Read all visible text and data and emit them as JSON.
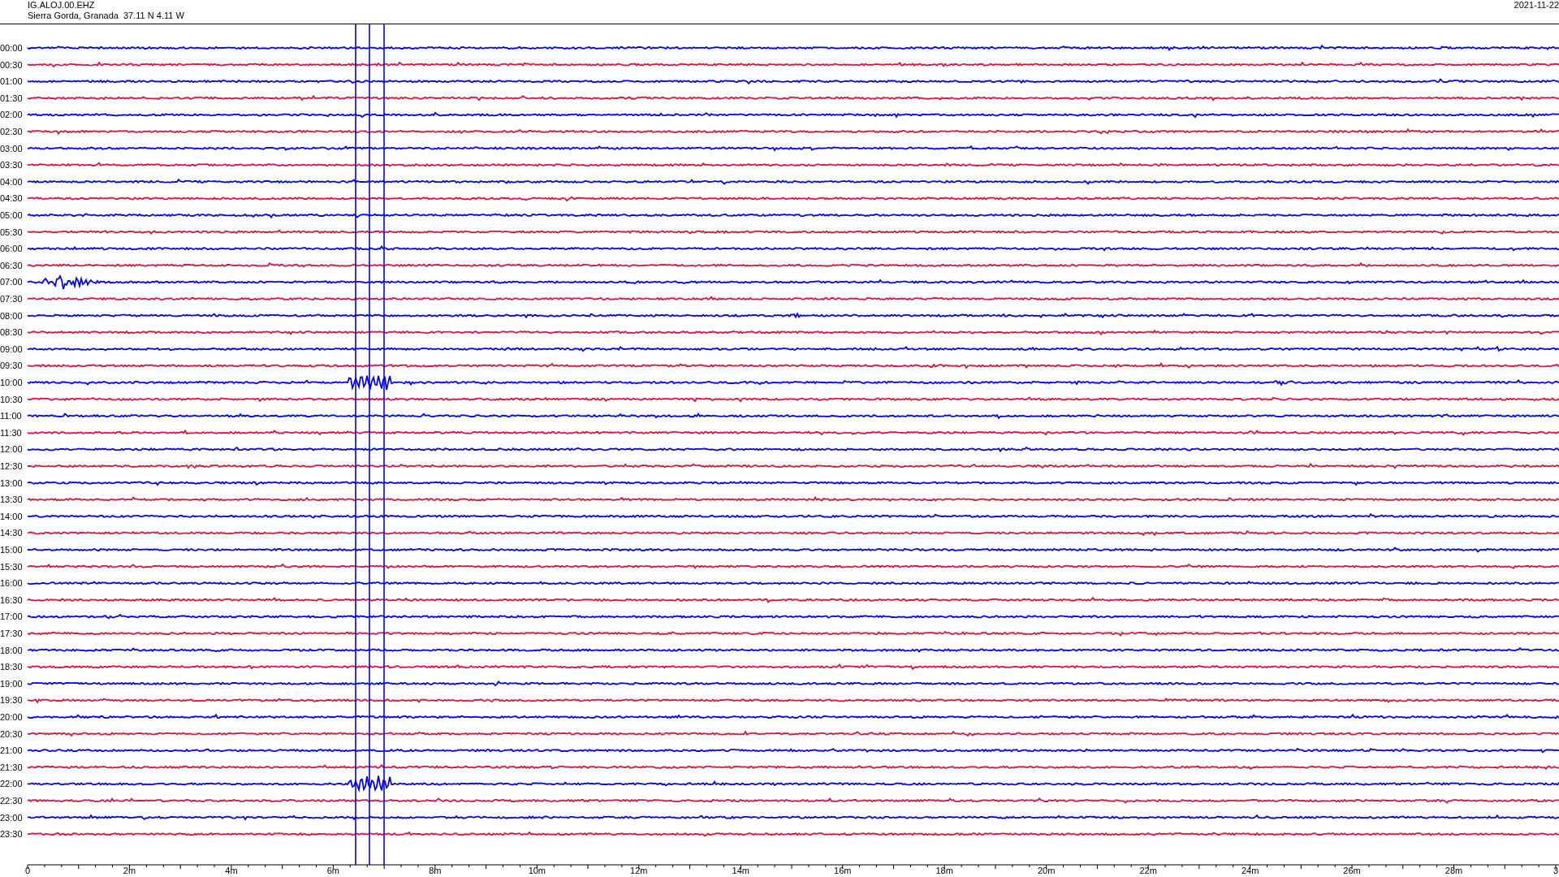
{
  "header": {
    "channel": "IG.ALOJ.00.EHZ",
    "station": "Sierra Gorda, Granada  37.11 N 4.11 W",
    "date": "2021-11-22"
  },
  "rows": [
    {
      "time": "00:00",
      "color": "#0000ff"
    },
    {
      "time": "00:30",
      "color": "#dc143c"
    },
    {
      "time": "01:00",
      "color": "#0000ff"
    },
    {
      "time": "01:30",
      "color": "#dc143c"
    },
    {
      "time": "02:00",
      "color": "#0000ff"
    },
    {
      "time": "02:30",
      "color": "#dc143c"
    },
    {
      "time": "03:00",
      "color": "#0000ff"
    },
    {
      "time": "03:30",
      "color": "#dc143c"
    },
    {
      "time": "04:00",
      "color": "#0000ff"
    },
    {
      "time": "04:30",
      "color": "#dc143c"
    },
    {
      "time": "05:00",
      "color": "#0000ff"
    },
    {
      "time": "05:30",
      "color": "#dc143c"
    },
    {
      "time": "06:00",
      "color": "#0000ff"
    },
    {
      "time": "06:30",
      "color": "#dc143c"
    },
    {
      "time": "07:00",
      "color": "#0000ff"
    },
    {
      "time": "07:30",
      "color": "#dc143c"
    },
    {
      "time": "08:00",
      "color": "#0000ff"
    },
    {
      "time": "08:30",
      "color": "#dc143c"
    },
    {
      "time": "09:00",
      "color": "#0000ff"
    },
    {
      "time": "09:30",
      "color": "#dc143c"
    },
    {
      "time": "10:00",
      "color": "#0000ff"
    },
    {
      "time": "10:30",
      "color": "#dc143c"
    },
    {
      "time": "11:00",
      "color": "#0000ff"
    },
    {
      "time": "11:30",
      "color": "#dc143c"
    },
    {
      "time": "12:00",
      "color": "#0000ff"
    },
    {
      "time": "12:30",
      "color": "#dc143c"
    },
    {
      "time": "13:00",
      "color": "#0000ff"
    },
    {
      "time": "13:30",
      "color": "#dc143c"
    },
    {
      "time": "14:00",
      "color": "#0000ff"
    },
    {
      "time": "14:30",
      "color": "#dc143c"
    },
    {
      "time": "15:00",
      "color": "#0000ff"
    },
    {
      "time": "15:30",
      "color": "#dc143c"
    },
    {
      "time": "16:00",
      "color": "#0000ff"
    },
    {
      "time": "16:30",
      "color": "#dc143c"
    },
    {
      "time": "17:00",
      "color": "#0000ff"
    },
    {
      "time": "17:30",
      "color": "#dc143c"
    },
    {
      "time": "18:00",
      "color": "#0000ff"
    },
    {
      "time": "18:30",
      "color": "#dc143c"
    },
    {
      "time": "19:00",
      "color": "#0000ff"
    },
    {
      "time": "19:30",
      "color": "#dc143c"
    },
    {
      "time": "20:00",
      "color": "#0000ff"
    },
    {
      "time": "20:30",
      "color": "#dc143c"
    },
    {
      "time": "21:00",
      "color": "#0000ff"
    },
    {
      "time": "21:30",
      "color": "#dc143c"
    },
    {
      "time": "22:00",
      "color": "#0000ff"
    },
    {
      "time": "22:30",
      "color": "#dc143c"
    },
    {
      "time": "23:00",
      "color": "#0000ff"
    },
    {
      "time": "23:30",
      "color": "#dc143c"
    }
  ],
  "x_axis": {
    "ticks": [
      "0",
      "2m",
      "4m",
      "6m",
      "8m",
      "10m",
      "12m",
      "14m",
      "16m",
      "18m",
      "20m",
      "22m",
      "24m",
      "26m",
      "28m",
      "3"
    ]
  }
}
